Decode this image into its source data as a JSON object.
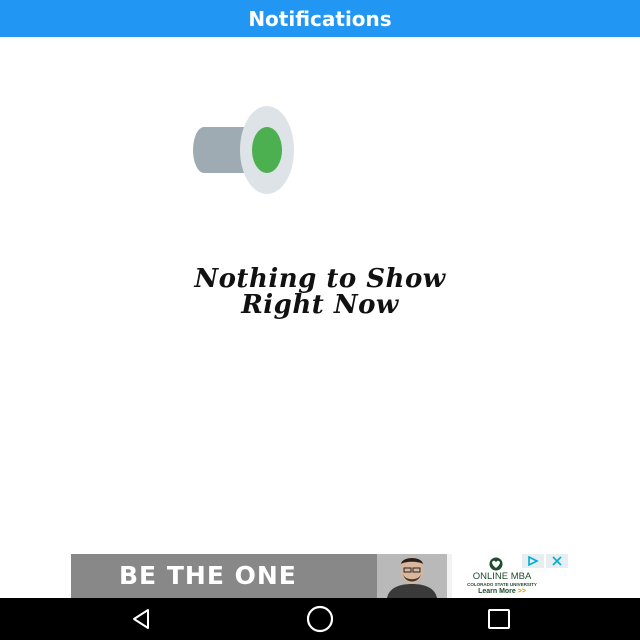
{
  "app_bar": {
    "title": "Notifications"
  },
  "empty_state": {
    "icon": "megaphone-icon",
    "line1": "Nothing to Show",
    "line2": "Right Now"
  },
  "ad": {
    "headline": "BE THE ONE",
    "brand": "ONLINE MBA",
    "school": "COLORADO STATE UNIVERSITY",
    "cta": "Learn More",
    "cta_arrows": ">>",
    "choices_icon": "ad-choices-icon",
    "close_icon": "close-icon"
  },
  "nav": {
    "back_icon": "back-icon",
    "home_icon": "home-icon",
    "recents_icon": "recents-icon"
  },
  "colors": {
    "app_bar": "#2196f3",
    "megaphone_body": "#9eabb3",
    "megaphone_bell": "#dde3e6",
    "megaphone_center": "#4caf50",
    "ad_green": "#1e4d2b"
  }
}
